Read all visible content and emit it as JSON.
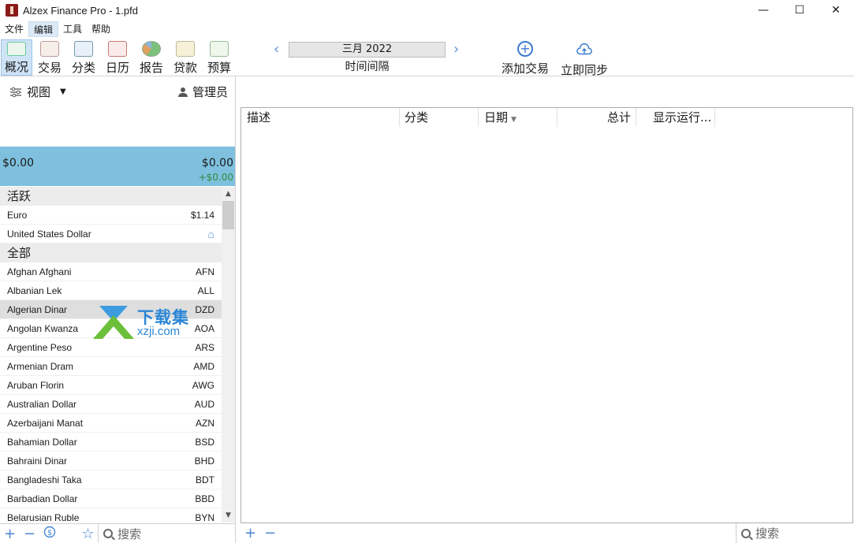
{
  "window": {
    "title": "Alzex Finance Pro - 1.pfd",
    "min": "—",
    "max": "☐",
    "close": "✕"
  },
  "menu": [
    "文件",
    "编辑",
    "工具",
    "帮助"
  ],
  "toolbar": {
    "buttons": [
      {
        "label": "概况",
        "icon": "overview-icon"
      },
      {
        "label": "交易",
        "icon": "transactions-icon"
      },
      {
        "label": "分类",
        "icon": "categories-icon"
      },
      {
        "label": "日历",
        "icon": "calendar-icon"
      },
      {
        "label": "报告",
        "icon": "reports-icon"
      },
      {
        "label": "贷款",
        "icon": "loans-icon"
      },
      {
        "label": "预算",
        "icon": "budget-icon"
      }
    ],
    "period": "三月 2022",
    "period_label": "时间间隔",
    "add_transaction": "添加交易",
    "sync_now": "立即同步"
  },
  "left": {
    "view_label": "视图",
    "user_label": "管理员",
    "balance_left": "$0.00",
    "balance_right": "$0.00",
    "balance_change": "+$0.00",
    "active_header": "活跃",
    "active": [
      {
        "name": "Euro",
        "value": "$1.14"
      },
      {
        "name": "United States Dollar",
        "value": ""
      }
    ],
    "all_header": "全部",
    "all": [
      {
        "name": "Afghan Afghani",
        "code": "AFN"
      },
      {
        "name": "Albanian Lek",
        "code": "ALL"
      },
      {
        "name": "Algerian Dinar",
        "code": "DZD"
      },
      {
        "name": "Angolan Kwanza",
        "code": "AOA"
      },
      {
        "name": "Argentine Peso",
        "code": "ARS"
      },
      {
        "name": "Armenian Dram",
        "code": "AMD"
      },
      {
        "name": "Aruban Florin",
        "code": "AWG"
      },
      {
        "name": "Australian Dollar",
        "code": "AUD"
      },
      {
        "name": "Azerbaijani Manat",
        "code": "AZN"
      },
      {
        "name": "Bahamian Dollar",
        "code": "BSD"
      },
      {
        "name": "Bahraini Dinar",
        "code": "BHD"
      },
      {
        "name": "Bangladeshi Taka",
        "code": "BDT"
      },
      {
        "name": "Barbadian Dollar",
        "code": "BBD"
      },
      {
        "name": "Belarusian Ruble",
        "code": "BYN"
      }
    ],
    "search_placeholder": "搜索"
  },
  "table": {
    "columns": [
      "描述",
      "分类",
      "日期",
      "总计",
      "显示运行..."
    ]
  },
  "right": {
    "search_placeholder": "搜索"
  },
  "watermark": {
    "title": "下载集",
    "subtitle": "xzji.com"
  },
  "colors": {
    "balance_bg": "#7ec0de",
    "accent": "#3b7bd0",
    "positive": "#2e8b3c"
  }
}
